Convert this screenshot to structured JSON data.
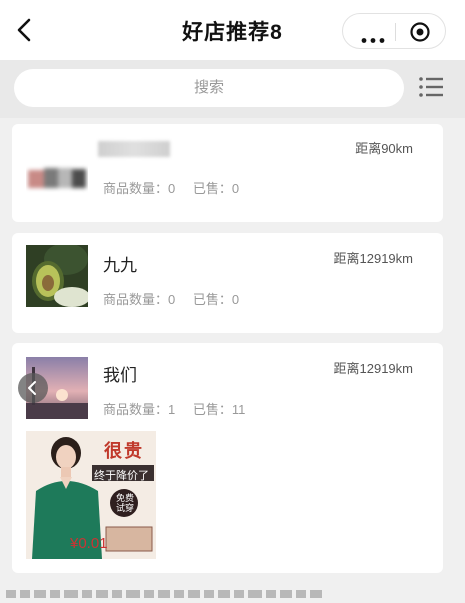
{
  "navbar": {
    "title": "好店推荐8"
  },
  "search": {
    "placeholder": "搜索"
  },
  "shops": [
    {
      "name": "",
      "distance": "距离90km",
      "goods_label": "商品数量：0",
      "sold_label": "已售：0"
    },
    {
      "name": "九九",
      "distance": "距离12919km",
      "goods_label": "商品数量：0",
      "sold_label": "已售：0"
    },
    {
      "name": "我们",
      "distance": "距离12919km",
      "goods_label": "商品数量：1",
      "sold_label": "已售：11",
      "product": {
        "tag1": "很贵",
        "tag2": "终于降价了",
        "badge_line1": "免费",
        "badge_line2": "试穿",
        "price": "¥0.01"
      }
    }
  ],
  "colors": {
    "navbar_bg": "#ffffff",
    "page_bg": "#f0f0f0",
    "price": "#cc3333",
    "tag_red": "#c0392b"
  },
  "icons": {
    "back": "back-arrow-icon",
    "more": "more-dots-icon",
    "close": "target-circle-icon",
    "list": "list-menu-icon",
    "carousel_prev": "chevron-left-icon"
  }
}
